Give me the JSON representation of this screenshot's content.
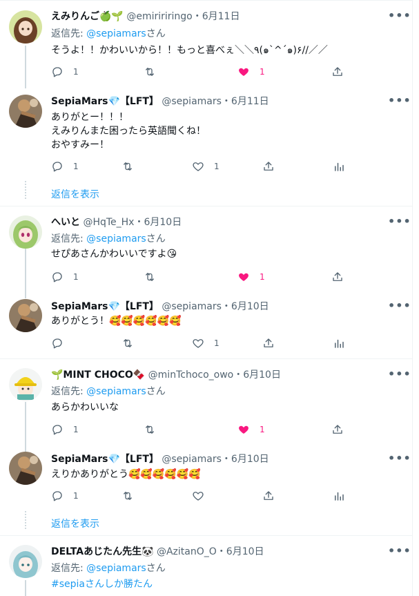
{
  "more_label": "•••",
  "show_replies_label": "返信を表示",
  "reply_prefix": "返信先: ",
  "reply_suffix": "さん",
  "colors": {
    "accent": "#1d9bf0",
    "like": "#f91880",
    "muted": "#536471"
  },
  "tweets": [
    {
      "name": "えみりんご🍏🌱",
      "handle": "@emiririringo",
      "date": "・6月11日",
      "reply_to": "@sepiamars",
      "lines": [
        "そうよ！！かわいいから！！もっと喜べぇ＼＼٩(๑`^´๑)۶//／／"
      ],
      "reply_count": "1",
      "retweet_count": "",
      "like_count": "1",
      "liked": true,
      "avatar": "avatar-girl-brown-hair-icon"
    },
    {
      "name": "SepiaMars💎【LFT】",
      "handle": "@sepiamars",
      "date": "・6月11日",
      "reply_to": "",
      "lines": [
        "ありがとー！！！",
        "えみりんまた困ったら英語聞くね！",
        "おやすみー！"
      ],
      "reply_count": "1",
      "retweet_count": "",
      "like_count": "1",
      "liked": false,
      "avatar": "avatar-wooden-doll-icon"
    },
    {
      "name": "へいと",
      "handle": "@HqTe_Hx",
      "date": "・6月10日",
      "reply_to": "@sepiamars",
      "lines": [
        "せぴあさんかわいいですよ😘"
      ],
      "reply_count": "1",
      "retweet_count": "",
      "like_count": "1",
      "liked": true,
      "avatar": "avatar-green-hair-girl-icon"
    },
    {
      "name": "SepiaMars💎【LFT】",
      "handle": "@sepiamars",
      "date": "・6月10日",
      "reply_to": "",
      "lines": [
        "ありがとう！🥰🥰🥰🥰🥰🥰"
      ],
      "reply_count": "",
      "retweet_count": "",
      "like_count": "1",
      "liked": false,
      "avatar": "avatar-wooden-doll-icon"
    },
    {
      "name": "🌱MINT CHOCO🍫",
      "handle": "@minTchoco_owo",
      "date": "・6月10日",
      "reply_to": "@sepiamars",
      "lines": [
        "あらかわいいな"
      ],
      "reply_count": "1",
      "retweet_count": "",
      "like_count": "1",
      "liked": true,
      "avatar": "avatar-yellow-hat-icon"
    },
    {
      "name": "SepiaMars💎【LFT】",
      "handle": "@sepiamars",
      "date": "・6月10日",
      "reply_to": "",
      "lines": [
        "えりかありがとう🥰🥰🥰🥰🥰🥰"
      ],
      "reply_count": "1",
      "retweet_count": "",
      "like_count": "",
      "liked": false,
      "avatar": "avatar-wooden-doll-icon"
    },
    {
      "name": "DELTAあじたん先生🐼",
      "handle": "@AzitanO_O",
      "date": "・6月10日",
      "reply_to": "@sepiamars",
      "lines": [
        "#sepiaさんしか勝たん"
      ],
      "reply_count": "",
      "retweet_count": "",
      "like_count": "",
      "liked": false,
      "avatar": "avatar-teal-hair-girl-icon"
    }
  ]
}
